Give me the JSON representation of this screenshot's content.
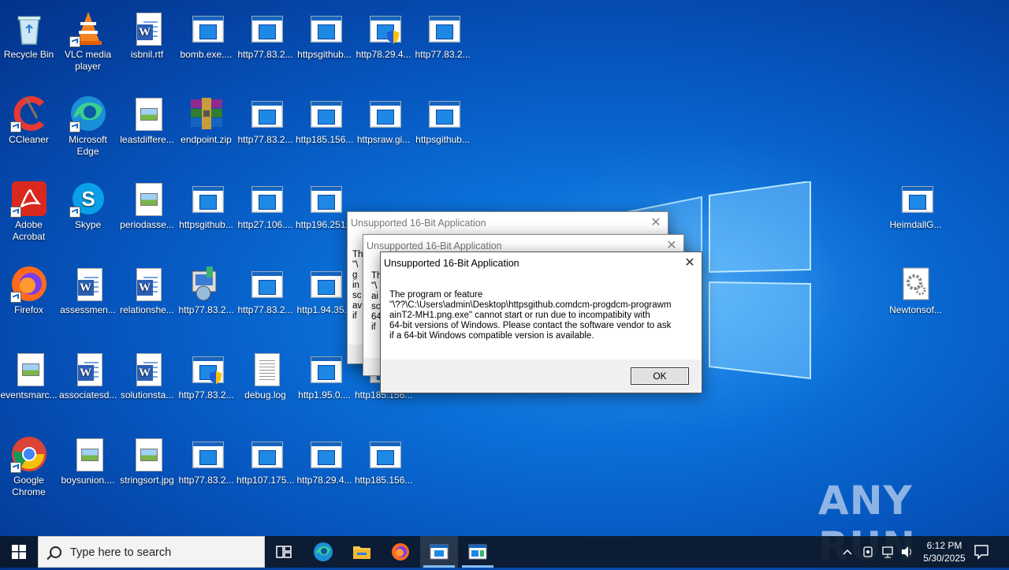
{
  "desktop_icons": [
    {
      "label": "Recycle Bin",
      "type": "recycle"
    },
    {
      "label": "VLC media player",
      "type": "vlc"
    },
    {
      "label": "isbnil.rtf",
      "type": "word"
    },
    {
      "label": "bomb.exe....",
      "type": "app"
    },
    {
      "label": "http77.83.2...",
      "type": "app"
    },
    {
      "label": "httpsgithub...",
      "type": "app"
    },
    {
      "label": "http78.29.4...",
      "type": "app-shield"
    },
    {
      "label": "http77.83.2...",
      "type": "app"
    },
    {
      "label": "CCleaner",
      "type": "ccleaner"
    },
    {
      "label": "Microsoft Edge",
      "type": "edge"
    },
    {
      "label": "leastdiffere...",
      "type": "image"
    },
    {
      "label": "endpoint.zip",
      "type": "zip"
    },
    {
      "label": "http77.83.2...",
      "type": "app"
    },
    {
      "label": "http185.156...",
      "type": "app"
    },
    {
      "label": "httpsraw.gi...",
      "type": "app"
    },
    {
      "label": "httpsgithub...",
      "type": "app"
    },
    {
      "label": "Adobe Acrobat",
      "type": "acrobat"
    },
    {
      "label": "Skype",
      "type": "skype"
    },
    {
      "label": "periodasse...",
      "type": "image"
    },
    {
      "label": "httpsgithub...",
      "type": "app"
    },
    {
      "label": "http27.106....",
      "type": "app"
    },
    {
      "label": "http196.251...",
      "type": "app"
    },
    {
      "label": "Firefox",
      "type": "firefox"
    },
    {
      "label": "assessmen...",
      "type": "word"
    },
    {
      "label": "relationshe...",
      "type": "word"
    },
    {
      "label": "http77.83.2...",
      "type": "installer"
    },
    {
      "label": "http77.83.2...",
      "type": "app"
    },
    {
      "label": "http1.94.35...",
      "type": "app"
    },
    {
      "label": "eventsmarc...",
      "type": "image"
    },
    {
      "label": "associatesd...",
      "type": "word"
    },
    {
      "label": "solutionsta...",
      "type": "word"
    },
    {
      "label": "http77.83.2...",
      "type": "app-shield"
    },
    {
      "label": "debug.log",
      "type": "text"
    },
    {
      "label": "http1.95.0....",
      "type": "app"
    },
    {
      "label": "http185.156...",
      "type": "app"
    },
    {
      "label": "Google Chrome",
      "type": "chrome"
    },
    {
      "label": "boysunion....",
      "type": "image"
    },
    {
      "label": "stringsort.jpg",
      "type": "image"
    },
    {
      "label": "http77.83.2...",
      "type": "app"
    },
    {
      "label": "http107.175....",
      "type": "app"
    },
    {
      "label": "http78.29.4...",
      "type": "app"
    },
    {
      "label": "http185.156...",
      "type": "app"
    },
    {
      "label": "HeimdallG...",
      "type": "app"
    },
    {
      "label": "Newtonsof...",
      "type": "gear"
    }
  ],
  "dialogs": [
    {
      "title": "Unsupported 16-Bit Application",
      "partial_lines": [
        "Th",
        "\"\\",
        "g",
        "in",
        "sc",
        "av",
        "if"
      ]
    },
    {
      "title": "Unsupported 16-Bit Application",
      "partial_lines": [
        "Th",
        "\"\\",
        "ai",
        "sc",
        "64",
        "if"
      ]
    },
    {
      "title": "Unsupported 16-Bit Application",
      "message": "The program or feature\n\"\\??\\C:\\Users\\admin\\Desktop\\httpsgithub.comdcm-progdcm-prograwm\nainT2-MH1.png.exe\" cannot start or run due to incompatibity with\n64-bit versions of Windows. Please contact the software vendor to ask\nif a 64-bit Windows compatible version is available.",
      "ok_label": "OK"
    }
  ],
  "taskbar": {
    "search_placeholder": "Type here to search",
    "time": "6:12 PM",
    "date": "5/30/2025"
  },
  "watermark": "ANY RUN"
}
